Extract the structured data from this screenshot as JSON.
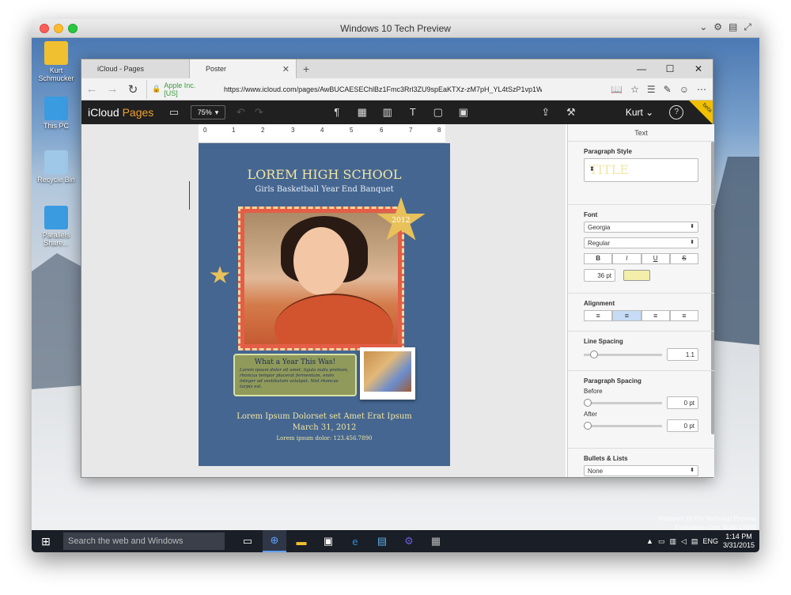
{
  "mac_window": {
    "title": "Windows 10 Tech Preview"
  },
  "desktop": {
    "icons": [
      {
        "label": "Kurt Schmucker",
        "icon": "user-folder-icon",
        "color": "#f0c030"
      },
      {
        "label": "This PC",
        "icon": "computer-icon",
        "color": "#3a9be0"
      },
      {
        "label": "Recycle Bin",
        "icon": "recycle-bin-icon",
        "color": "#9fc8e8"
      },
      {
        "label": "Parallels Share...",
        "icon": "shared-folder-icon",
        "color": "#3a9be0"
      }
    ],
    "watermark_line1": "Windows 10 Pro Technical Preview",
    "watermark_line2": "Evaluation copy. Build 10049"
  },
  "taskbar": {
    "search_placeholder": "Search the web and Windows",
    "language": "ENG",
    "time": "1:14 PM",
    "date": "3/31/2015"
  },
  "browser": {
    "tabs": [
      {
        "label": "iCloud - Pages",
        "active": false
      },
      {
        "label": "Poster",
        "active": true
      }
    ],
    "cert_label": "Apple Inc. [US]",
    "url": "https://www.icloud.com/pages/AwBUCAESEChlBz1Fmc3Rrl3ZU9spEaKTXz-zM7pH_YL4tSzP1vp1W"
  },
  "app": {
    "brand_icloud": "iCloud",
    "brand_pages": "Pages",
    "zoom": "75%",
    "user": "Kurt",
    "beta": "beta"
  },
  "ruler": {
    "marks": [
      "0",
      "1",
      "2",
      "3",
      "4",
      "5",
      "6",
      "7",
      "8"
    ]
  },
  "poster": {
    "title": "LOREM HIGH SCHOOL",
    "subtitle": "Girls Basketball Year End Banquet",
    "badge_year": "2012",
    "note_title": "What a Year This Was!",
    "note_body": "Lorem ipsum dolor sit amet, ligula nulla pretium, rhoncus tempor placerat fermentum, enim integer ad vestibulum volutpat. Nisl rhoncus turpis est.",
    "footer_line1": "Lorem Ipsum Dolorset set Amet Erat Ipsum",
    "footer_line2": "March 31, 2012",
    "footer_line3": "Lorem ipsum dolor: 123.456.7890"
  },
  "inspector": {
    "header": "Text",
    "paragraph_style_label": "Paragraph Style",
    "paragraph_style_value": "TITLE",
    "font_label": "Font",
    "font_family": "Georgia",
    "font_weight": "Regular",
    "bold": "B",
    "italic": "I",
    "underline": "U",
    "strike": "S",
    "font_size": "36 pt",
    "text_color": "#f3eeaa",
    "alignment_label": "Alignment",
    "line_spacing_label": "Line Spacing",
    "line_spacing_value": "1.1",
    "paragraph_spacing_label": "Paragraph Spacing",
    "before_label": "Before",
    "before_value": "0 pt",
    "after_label": "After",
    "after_value": "0 pt",
    "bullets_label": "Bullets & Lists",
    "bullets_value": "None"
  }
}
